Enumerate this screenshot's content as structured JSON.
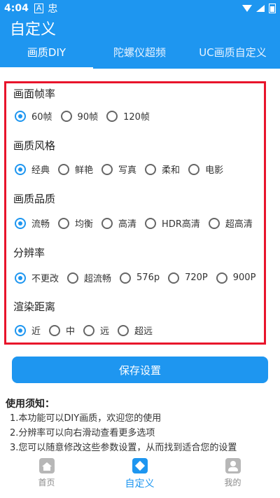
{
  "status_bar": {
    "time": "4:04",
    "icon1": "A",
    "icon2": "忠"
  },
  "app": {
    "title": "自定义"
  },
  "tabs": [
    {
      "label": "画质DIY"
    },
    {
      "label": "陀螺仪超频"
    },
    {
      "label": "UC画质自定义"
    }
  ],
  "sections": [
    {
      "title": "画面帧率",
      "options": [
        "60帧",
        "90帧",
        "120帧"
      ]
    },
    {
      "title": "画质风格",
      "options": [
        "经典",
        "鲜艳",
        "写真",
        "柔和",
        "电影"
      ]
    },
    {
      "title": "画质品质",
      "options": [
        "流畅",
        "均衡",
        "高清",
        "HDR高清",
        "超高清"
      ]
    },
    {
      "title": "分辨率",
      "options": [
        "不更改",
        "超流畅",
        "576p",
        "720P",
        "900P"
      ]
    },
    {
      "title": "渲染距离",
      "options": [
        "近",
        "中",
        "远",
        "超远"
      ]
    }
  ],
  "save_button": "保存设置",
  "notice": {
    "title": "使用须知：",
    "lines": [
      "1.本功能可以DIY画质，欢迎您的使用",
      "2.分辨率可以向右滑动查看更多选项",
      "3.您可以随意修改这些参数设置，从而找到适合您的设置"
    ]
  },
  "bottom_nav": [
    {
      "label": "首页"
    },
    {
      "label": "自定义"
    },
    {
      "label": "我的"
    }
  ],
  "colors": {
    "primary": "#1e96f0",
    "border_red": "#e8142b"
  }
}
